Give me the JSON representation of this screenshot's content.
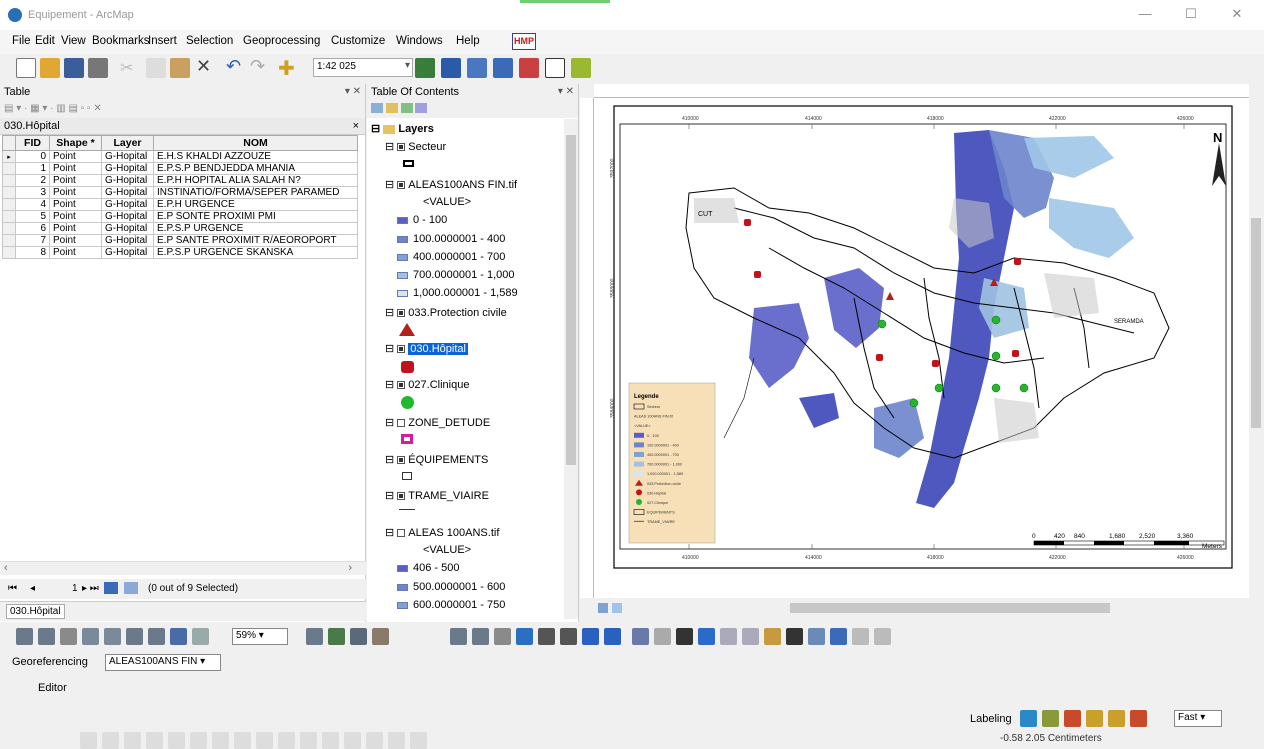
{
  "window": {
    "title": "Equipement - ArcMap",
    "minimize": "—",
    "maximize": "☐",
    "close": "✕"
  },
  "menu": [
    "File",
    "Edit",
    "View",
    "Bookmarks",
    "Insert",
    "Selection",
    "Geoprocessing",
    "Customize",
    "Windows",
    "Help"
  ],
  "menu_badge": "HMP",
  "toolbar": {
    "scale": "1:42 025"
  },
  "table": {
    "panel_title": "Table",
    "pin": "▾ ✕",
    "layer_title": "030.Hôpital",
    "columns": [
      "FID",
      "Shape *",
      "Layer",
      "NOM"
    ],
    "rows": [
      [
        "0",
        "Point",
        "G-Hopital",
        "E.H.S KHALDI AZZOUZE"
      ],
      [
        "1",
        "Point",
        "G-Hopital",
        "E.P.S.P BENDJEDDA MHANIA"
      ],
      [
        "2",
        "Point",
        "G-Hopital",
        "E.P.H HOPITAL ALIA SALAH N?"
      ],
      [
        "3",
        "Point",
        "G-Hopital",
        "INSTINATIO/FORMA/SEPER PARAMED"
      ],
      [
        "4",
        "Point",
        "G-Hopital",
        "E.P.H URGENCE"
      ],
      [
        "5",
        "Point",
        "G-Hopital",
        "E.P SONTE PROXIMI PMI"
      ],
      [
        "6",
        "Point",
        "G-Hopital",
        "E.P.S.P URGENCE"
      ],
      [
        "7",
        "Point",
        "G-Hopital",
        "E.P SANTE PROXIMIT R/AEOROPORT"
      ],
      [
        "8",
        "Point",
        "G-Hopital",
        "E.P.S.P URGENCE SKANSKA"
      ]
    ],
    "record_nav": "1",
    "selection_status": "(0 out of 9 Selected)",
    "tab_label": "030.Hôpital"
  },
  "toc": {
    "title": "Table Of Contents",
    "root": "Layers",
    "items": {
      "secteur": "Secteur",
      "aleas_fin": "ALEAS100ANS FIN.tif",
      "value_a": "<VALUE>",
      "r1": "0 - 100",
      "r2": "100.0000001 - 400",
      "r3": "400.0000001 - 700",
      "r4": "700.0000001 - 1,000",
      "r5": "1,000.000001 - 1,589",
      "protection": "033.Protection civile",
      "hopital": "030.Hôpital",
      "clinique": "027.Clinique",
      "zone": "ZONE_DETUDE",
      "equip": "ÉQUIPEMENTS",
      "trame": "TRAME_VIAIRE",
      "aleas": "ALEAS 100ANS.tif",
      "value_b": "<VALUE>",
      "s1": "406 - 500",
      "s2": "500.0000001 - 600",
      "s3": "600.0000001 - 750"
    }
  },
  "map": {
    "coords_top": [
      "410000",
      "414000",
      "418000",
      "422000",
      "426000"
    ],
    "coords_bottom": [
      "410000",
      "414000",
      "418000",
      "422000",
      "426000"
    ],
    "coords_left": [
      "3592000",
      "3588000",
      "3584000"
    ],
    "north": "N",
    "legend": {
      "title": "Legende",
      "items": [
        "Secteur",
        "ALEAS 100ANS FIN.tif",
        "<VALUE>",
        "0 - 100",
        "100.0000001 - 400",
        "400.0000001 - 700",
        "700.0000001 - 1,000",
        "1,000.000001 - 1,589",
        "033.Protection civile",
        "030.Hôpital",
        "027.Clinique",
        "EQUIPEMENTS",
        "TRAME_VIAIRE"
      ]
    },
    "scale_labels": [
      "0",
      "420",
      "840",
      "1,680",
      "2,520",
      "3,360"
    ],
    "scale_unit": "Meters",
    "place_labels": [
      "CUT",
      "SERAMDA"
    ]
  },
  "georef": {
    "label": "Georeferencing",
    "layer": "ALEAS100ANS FIN"
  },
  "editor": {
    "label": "Editor"
  },
  "labeling": {
    "label": "Labeling",
    "mode": "Fast"
  },
  "zoom": "59%",
  "status": "-0.58  2.05 Centimeters",
  "colors": {
    "accent": "#0a64d8",
    "flood_dark": "#3b46b8",
    "flood_light": "#9fc6e8",
    "hospital": "#c0141a",
    "protection": "#b3201a",
    "clinique": "#22b82a",
    "legend_bg": "#f7e0b8"
  }
}
